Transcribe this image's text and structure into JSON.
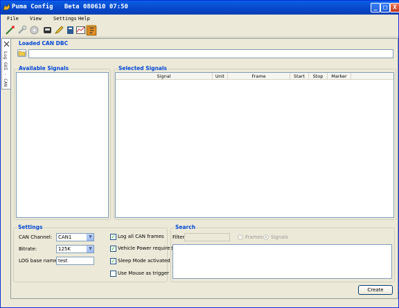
{
  "window": {
    "title": "Puma Config   Beta 080610 07:50",
    "minimize": "_",
    "maximize": "□",
    "close": "X"
  },
  "menu": [
    "File",
    "View",
    "Settings",
    "Help"
  ],
  "toolbar": {
    "icons": [
      "wand-icon",
      "wrench-icon",
      "disk-icon",
      "can-icon",
      "pen-icon",
      "book-icon",
      "chart-icon",
      "config-icon"
    ]
  },
  "sidetab": {
    "label": "Log GUI - CAN"
  },
  "loaded_dbc": {
    "title": "Loaded CAN DBC",
    "path": ""
  },
  "available": {
    "title": "Available Signals"
  },
  "selected": {
    "title": "Selected Signals",
    "columns": [
      "Signal",
      "Unit",
      "Frame",
      "Start",
      "Stop",
      "Marker"
    ]
  },
  "settings": {
    "title": "Settings",
    "can_channel_label": "CAN Channel:",
    "can_channel_value": "CAN1",
    "bitrate_label": "Bitrate:",
    "bitrate_value": "125K",
    "log_base_label": "LOG base name:",
    "log_base_value": "test",
    "checks": [
      {
        "label": "Log all CAN frames",
        "checked": true
      },
      {
        "label": "Vehicle Power required",
        "checked": true
      },
      {
        "label": "Sleep Mode activated",
        "checked": true
      },
      {
        "label": "Use Mouse as trigger",
        "checked": false
      }
    ]
  },
  "search": {
    "title": "Search",
    "filter_label": "Filter",
    "filter_value": "",
    "radio_frames": "Frames",
    "radio_signals": "Signals"
  },
  "create_button": "Create"
}
